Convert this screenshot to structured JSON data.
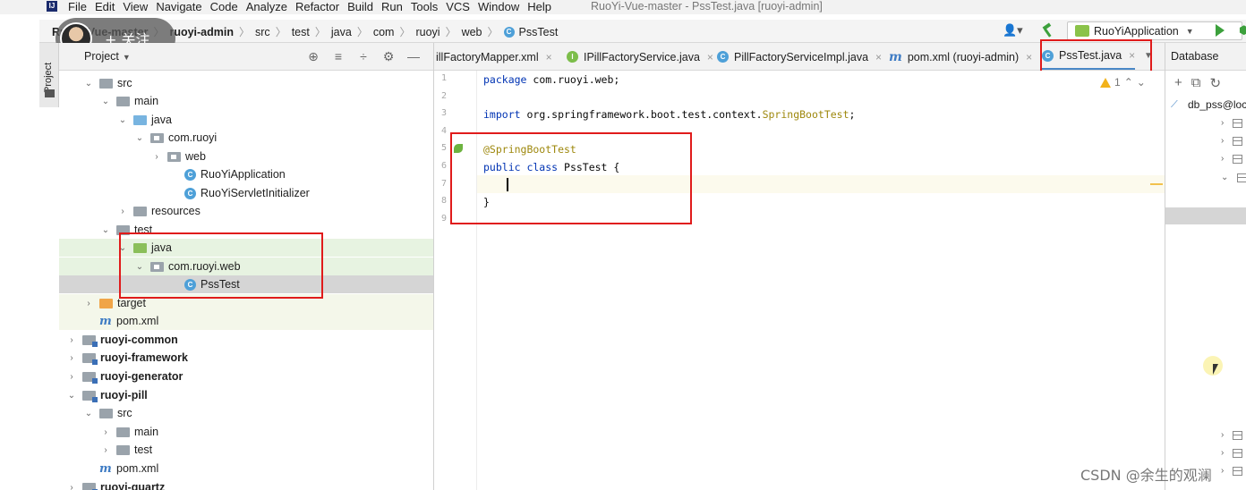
{
  "menubar": {
    "app_icon": "IJ",
    "items": [
      "File",
      "Edit",
      "View",
      "Navigate",
      "Code",
      "Analyze",
      "Refactor",
      "Build",
      "Run",
      "Tools",
      "VCS",
      "Window",
      "Help"
    ],
    "window_title": "RuoYi-Vue-master - PssTest.java [ruoyi-admin]"
  },
  "breadcrumb": [
    "RuoYi-Vue-master",
    "ruoyi-admin",
    "src",
    "test",
    "java",
    "com",
    "ruoyi",
    "web",
    "PssTest"
  ],
  "toolbar": {
    "user_icon": "user-icon",
    "run_config": "RuoYiApplication",
    "colors": {
      "run": "#3ca03c",
      "build": "#3ca03c"
    }
  },
  "follow_badge": "+ 关注",
  "project_panel": {
    "stripe_label": "Project",
    "title": "Project",
    "tools": [
      "⊕",
      "≡",
      "÷",
      "⚙",
      "—"
    ],
    "tree": [
      {
        "label": "src",
        "indent": 2,
        "arrow": "⌄",
        "icon": "grey"
      },
      {
        "label": "main",
        "indent": 3,
        "arrow": "⌄",
        "icon": "grey"
      },
      {
        "label": "java",
        "indent": 4,
        "arrow": "⌄",
        "icon": "blue"
      },
      {
        "label": "com.ruoyi",
        "indent": 5,
        "arrow": "⌄",
        "icon": "pkg"
      },
      {
        "label": "web",
        "indent": 6,
        "arrow": "›",
        "icon": "pkg"
      },
      {
        "label": "RuoYiApplication",
        "indent": 7,
        "arrow": "",
        "icon": "class"
      },
      {
        "label": "RuoYiServletInitializer",
        "indent": 7,
        "arrow": "",
        "icon": "class"
      },
      {
        "label": "resources",
        "indent": 4,
        "arrow": "›",
        "icon": "grey"
      },
      {
        "label": "test",
        "indent": 3,
        "arrow": "⌄",
        "icon": "grey"
      },
      {
        "label": "java",
        "indent": 4,
        "arrow": "⌄",
        "icon": "green"
      },
      {
        "label": "com.ruoyi.web",
        "indent": 5,
        "arrow": "⌄",
        "icon": "pkg"
      },
      {
        "label": "PssTest",
        "indent": 7,
        "arrow": "",
        "icon": "class"
      },
      {
        "label": "target",
        "indent": 2,
        "arrow": "›",
        "icon": "orange"
      },
      {
        "label": "pom.xml",
        "indent": 2,
        "arrow": "",
        "icon": "maven"
      },
      {
        "label": "ruoyi-common",
        "indent": 1,
        "arrow": "›",
        "icon": "module",
        "bold": true
      },
      {
        "label": "ruoyi-framework",
        "indent": 1,
        "arrow": "›",
        "icon": "module",
        "bold": true
      },
      {
        "label": "ruoyi-generator",
        "indent": 1,
        "arrow": "›",
        "icon": "module",
        "bold": true
      },
      {
        "label": "ruoyi-pill",
        "indent": 1,
        "arrow": "⌄",
        "icon": "module",
        "bold": true
      },
      {
        "label": "src",
        "indent": 2,
        "arrow": "⌄",
        "icon": "grey"
      },
      {
        "label": "main",
        "indent": 3,
        "arrow": "›",
        "icon": "grey"
      },
      {
        "label": "test",
        "indent": 3,
        "arrow": "›",
        "icon": "grey"
      },
      {
        "label": "pom.xml",
        "indent": 2,
        "arrow": "",
        "icon": "maven"
      },
      {
        "label": "ruoyi-quartz",
        "indent": 1,
        "arrow": "›",
        "icon": "module",
        "bold": true
      }
    ]
  },
  "tabs": [
    {
      "label": "illFactoryMapper.xml",
      "icon": "none",
      "active": false
    },
    {
      "label": "IPillFactoryService.java",
      "icon": "interface",
      "active": false
    },
    {
      "label": "PillFactoryServiceImpl.java",
      "icon": "class",
      "active": false
    },
    {
      "label": "pom.xml (ruoyi-admin)",
      "icon": "maven",
      "active": false
    },
    {
      "label": "PssTest.java",
      "icon": "class",
      "active": true
    }
  ],
  "editor": {
    "line_numbers": [
      "1",
      "2",
      "3",
      "4",
      "5",
      "6",
      "7",
      "8",
      "9"
    ],
    "inspection_count": "1",
    "code": {
      "l1_kw": "package",
      "l1_rest": " com.ruoyi.web;",
      "l3_kw": "import",
      "l3_rest": " org.springframework.boot.test.context.",
      "l3_cls": "SpringBootTest",
      "l3_end": ";",
      "l5_ann": "@SpringBootTest",
      "l6_kw": "public class",
      "l6_rest": " PssTest {",
      "l8": "}"
    }
  },
  "database_panel": {
    "title": "Database",
    "connection": "db_pss@loca",
    "tools": [
      "+",
      "⧉",
      "↻"
    ]
  },
  "watermark": "CSDN @余生的观澜"
}
